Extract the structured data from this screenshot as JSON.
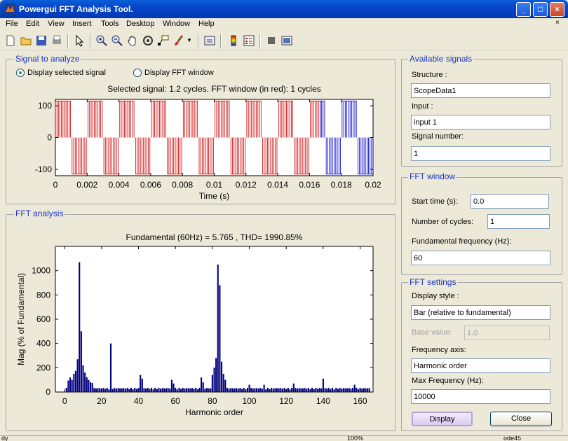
{
  "window": {
    "title": "Powergui FFT Analysis Tool."
  },
  "menu": [
    "File",
    "Edit",
    "View",
    "Insert",
    "Tools",
    "Desktop",
    "Window",
    "Help"
  ],
  "toolbar_icons": [
    "new-icon",
    "open-icon",
    "save-icon",
    "print-icon",
    "pointer-icon",
    "zoom-in-icon",
    "zoom-out-icon",
    "pan-icon",
    "rotate-icon",
    "data-cursor-icon",
    "brush-icon",
    "link-icon",
    "colorbar-icon",
    "legend-icon",
    "hide-plot-tools-icon",
    "show-plot-tools-icon"
  ],
  "signal_panel": {
    "title": "Signal to analyze",
    "radio_selected": "Display selected signal",
    "radio_fft": "Display FFT window",
    "plot_title": "Selected signal: 1.2 cycles. FFT window (in red): 1 cycles",
    "xlabel": "Time (s)"
  },
  "fft_panel": {
    "title": "FFT analysis",
    "plot_title": "Fundamental (60Hz) = 5.765 , THD= 1990.85%",
    "xlabel": "Harmonic order",
    "ylabel": "Mag (% of Fundamental)"
  },
  "available_signals": {
    "title": "Available signals",
    "structure_label": "Structure :",
    "structure_value": "ScopeData1",
    "input_label": "Input :",
    "input_value": "input 1",
    "signal_number_label": "Signal number:",
    "signal_number_value": "1"
  },
  "fft_window": {
    "title": "FFT window",
    "start_time_label": "Start time (s):",
    "start_time_value": "0.0",
    "cycles_label": "Number of cycles:",
    "cycles_value": "1",
    "fund_freq_label": "Fundamental frequency (Hz):",
    "fund_freq_value": "60"
  },
  "fft_settings": {
    "title": "FFT settings",
    "display_style_label": "Display style :",
    "display_style_value": "Bar (relative to fundamental)",
    "base_value_label": "Base value:",
    "base_value_value": "1.0",
    "freq_axis_label": "Frequency axis:",
    "freq_axis_value": "Harmonic order",
    "max_freq_label": "Max Frequency (Hz):",
    "max_freq_value": "10000",
    "display_button": "Display",
    "close_button": "Close"
  },
  "status": {
    "left": "dy",
    "mid": "100%",
    "right": "ode45"
  },
  "colors": {
    "bar": "#00007f",
    "fft_window": "#cc0000",
    "signal": "#0000cc",
    "panel_title": "#1a38c6"
  },
  "chart_data": [
    {
      "type": "line",
      "title": "Selected signal: 1.2 cycles. FFT window (in red): 1 cycles",
      "xlabel": "Time (s)",
      "ylabel": "",
      "xlim": [
        0,
        0.02
      ],
      "ylim": [
        -120,
        120
      ],
      "xticks": [
        "0",
        "0.002",
        "0.004",
        "0.006",
        "0.008",
        "0.01",
        "0.012",
        "0.014",
        "0.016",
        "0.018",
        "0.02"
      ],
      "yticks": [
        "100",
        "0",
        "-100"
      ],
      "grid": false,
      "series": [
        {
          "color": "#cc0000",
          "segments": [
            {
              "t0": 0.0,
              "t1": 0.00095,
              "v": 115
            },
            {
              "t0": 0.00105,
              "t1": 0.00195,
              "v": -115
            },
            {
              "t0": 0.00205,
              "t1": 0.00295,
              "v": 115
            },
            {
              "t0": 0.00305,
              "t1": 0.00395,
              "v": -115
            },
            {
              "t0": 0.00405,
              "t1": 0.00495,
              "v": 115
            },
            {
              "t0": 0.00505,
              "t1": 0.00595,
              "v": -115
            },
            {
              "t0": 0.00605,
              "t1": 0.00695,
              "v": 115
            },
            {
              "t0": 0.00705,
              "t1": 0.00795,
              "v": -115
            },
            {
              "t0": 0.00805,
              "t1": 0.00895,
              "v": 115
            },
            {
              "t0": 0.00905,
              "t1": 0.00995,
              "v": -115
            },
            {
              "t0": 0.01005,
              "t1": 0.01095,
              "v": 115
            },
            {
              "t0": 0.01105,
              "t1": 0.01195,
              "v": -115
            },
            {
              "t0": 0.01205,
              "t1": 0.01295,
              "v": 115
            },
            {
              "t0": 0.01305,
              "t1": 0.01395,
              "v": -115
            },
            {
              "t0": 0.01405,
              "t1": 0.01495,
              "v": 115
            },
            {
              "t0": 0.01505,
              "t1": 0.01595,
              "v": -115
            },
            {
              "t0": 0.01605,
              "t1": 0.01667,
              "v": 115
            }
          ]
        },
        {
          "color": "#0000cc",
          "segments": [
            {
              "t0": 0.01667,
              "t1": 0.01695,
              "v": 115
            },
            {
              "t0": 0.01705,
              "t1": 0.01795,
              "v": -115
            },
            {
              "t0": 0.01805,
              "t1": 0.01895,
              "v": 115
            },
            {
              "t0": 0.01905,
              "t1": 0.02,
              "v": -115
            }
          ]
        }
      ]
    },
    {
      "type": "bar",
      "title": "Fundamental (60Hz) = 5.765 , THD= 1990.85%",
      "xlabel": "Harmonic order",
      "ylabel": "Mag (% of Fundamental)",
      "xlim": [
        -5,
        167
      ],
      "ylim": [
        0,
        1200
      ],
      "xticks": [
        0,
        20,
        40,
        60,
        80,
        100,
        120,
        140,
        160
      ],
      "yticks": [
        0,
        200,
        400,
        600,
        800,
        1000
      ],
      "peaks": [
        {
          "x": 1,
          "y": 35
        },
        {
          "x": 2,
          "y": 95
        },
        {
          "x": 3,
          "y": 120
        },
        {
          "x": 4,
          "y": 100
        },
        {
          "x": 5,
          "y": 150
        },
        {
          "x": 6,
          "y": 175
        },
        {
          "x": 7,
          "y": 270
        },
        {
          "x": 8,
          "y": 1070
        },
        {
          "x": 9,
          "y": 500
        },
        {
          "x": 10,
          "y": 220
        },
        {
          "x": 11,
          "y": 160
        },
        {
          "x": 12,
          "y": 120
        },
        {
          "x": 13,
          "y": 100
        },
        {
          "x": 14,
          "y": 80
        },
        {
          "x": 15,
          "y": 75
        },
        {
          "x": 25,
          "y": 400
        },
        {
          "x": 41,
          "y": 140
        },
        {
          "x": 42,
          "y": 110
        },
        {
          "x": 58,
          "y": 100
        },
        {
          "x": 59,
          "y": 70
        },
        {
          "x": 74,
          "y": 120
        },
        {
          "x": 75,
          "y": 80
        },
        {
          "x": 80,
          "y": 140
        },
        {
          "x": 81,
          "y": 200
        },
        {
          "x": 82,
          "y": 280
        },
        {
          "x": 83,
          "y": 1050
        },
        {
          "x": 84,
          "y": 880
        },
        {
          "x": 85,
          "y": 250
        },
        {
          "x": 86,
          "y": 150
        },
        {
          "x": 87,
          "y": 100
        },
        {
          "x": 100,
          "y": 60
        },
        {
          "x": 108,
          "y": 60
        },
        {
          "x": 124,
          "y": 70
        },
        {
          "x": 140,
          "y": 110
        },
        {
          "x": 157,
          "y": 60
        }
      ],
      "baseline": 35
    }
  ]
}
